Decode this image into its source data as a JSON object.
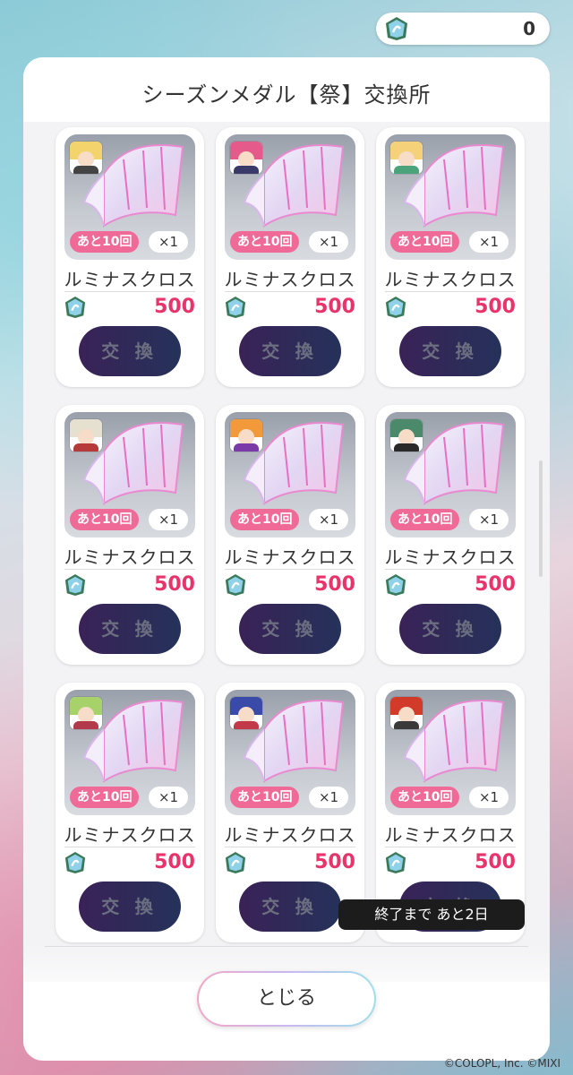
{
  "currency": {
    "icon": "season-medal-icon",
    "count": "0"
  },
  "title": "シーズンメダル【祭】交換所",
  "items": [
    {
      "character": "blonde-hero",
      "remaining": "あと10回",
      "quantity": "×1",
      "name": "ルミナスクロス",
      "price": "500",
      "button": "交 換",
      "hair": "#f3d36b",
      "outfit": "#444"
    },
    {
      "character": "rainbow-hair",
      "remaining": "あと10回",
      "quantity": "×1",
      "name": "ルミナスクロス",
      "price": "500",
      "button": "交 換",
      "hair": "#e45a8a",
      "outfit": "#3a3a6a"
    },
    {
      "character": "blonde-girl",
      "remaining": "あと10回",
      "quantity": "×1",
      "name": "ルミナスクロス",
      "price": "500",
      "button": "交 換",
      "hair": "#f5d27a",
      "outfit": "#4aa37a"
    },
    {
      "character": "silver-girl",
      "remaining": "あと10回",
      "quantity": "×1",
      "name": "ルミナスクロス",
      "price": "500",
      "button": "交 換",
      "hair": "#e6e0d0",
      "outfit": "#b63a3a"
    },
    {
      "character": "orange-hair-girl",
      "remaining": "あと10回",
      "quantity": "×1",
      "name": "ルミナスクロス",
      "price": "500",
      "button": "交 換",
      "hair": "#f29a3a",
      "outfit": "#7a3aa8"
    },
    {
      "character": "green-hair-boy",
      "remaining": "あと10回",
      "quantity": "×1",
      "name": "ルミナスクロス",
      "price": "500",
      "button": "交 換",
      "hair": "#4a8a6a",
      "outfit": "#2a2a2a"
    },
    {
      "character": "green-hair-girl",
      "remaining": "あと10回",
      "quantity": "×1",
      "name": "ルミナスクロス",
      "price": "500",
      "button": "交 換",
      "hair": "#a7d26a",
      "outfit": "#b23a4a"
    },
    {
      "character": "blue-hair-girl",
      "remaining": "あと10回",
      "quantity": "×1",
      "name": "ルミナスクロス",
      "price": "500",
      "button": "交 換",
      "hair": "#3a4aa8",
      "outfit": "#c23a4a"
    },
    {
      "character": "red-hair-boy",
      "remaining": "あと10回",
      "quantity": "×1",
      "name": "ルミナスクロス",
      "price": "500",
      "button": "交 換",
      "hair": "#d23a2a",
      "outfit": "#3a3a3a"
    }
  ],
  "end_notice": "終了まで あと2日",
  "close_label": "とじる",
  "copyright": "©COLOPL, Inc. ©MIXI",
  "colors": {
    "accent_pink": "#f06a98",
    "price_red": "#e8336b",
    "button_dark": "#2e2a58"
  }
}
